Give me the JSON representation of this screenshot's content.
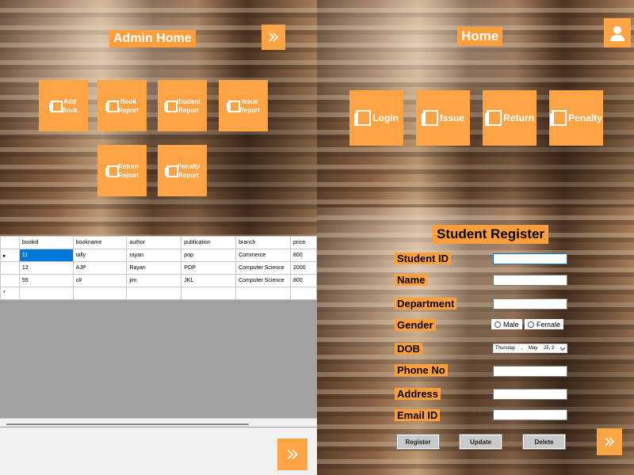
{
  "admin_home": {
    "title": "Admin Home",
    "tiles": [
      {
        "label_line1": "Add",
        "label_line2": "Book"
      },
      {
        "label_line1": "Book",
        "label_line2": "Report"
      },
      {
        "label_line1": "Student",
        "label_line2": "Report"
      },
      {
        "label_line1": "Issue",
        "label_line2": "Report"
      },
      {
        "label_line1": "Return",
        "label_line2": "Report"
      },
      {
        "label_line1": "Penalty",
        "label_line2": "Report"
      }
    ],
    "nav_icon": "double-chevron-right-icon"
  },
  "home": {
    "title": "Home",
    "user_icon": "user-icon",
    "tiles": [
      {
        "label": "Login"
      },
      {
        "label": "Issue"
      },
      {
        "label": "Return"
      },
      {
        "label": "Penalty"
      }
    ]
  },
  "book_grid": {
    "columns": [
      "bookid",
      "bookname",
      "author",
      "publication",
      "branch",
      "price"
    ],
    "rows": [
      [
        "11",
        "tally",
        "rayan",
        "pop",
        "Commerce",
        "800"
      ],
      [
        "12",
        "AJP",
        "Rayan",
        "POP",
        "Computer Science",
        "2000"
      ],
      [
        "55",
        "c#",
        "jim",
        "JKL",
        "Computer Science",
        "800"
      ]
    ],
    "current_row_marker": "▸",
    "new_row_marker": "*",
    "nav_icon": "double-chevron-right-icon"
  },
  "student_register": {
    "title": "Student Register",
    "labels": {
      "student_id": "Student ID",
      "name": "Name",
      "department": "Department",
      "gender": "Gender",
      "dob": "DOB",
      "phone": "Phone No",
      "address": "Address",
      "email": "Email ID"
    },
    "gender_options": [
      "Male",
      "Female"
    ],
    "dob_value": {
      "day": "Thursday",
      "sep": ",",
      "month": "May",
      "date": "25, 2"
    },
    "buttons": {
      "register": "Register",
      "update": "Update",
      "delete": "Delete"
    },
    "nav_icon": "double-chevron-right-icon"
  },
  "colors": {
    "accent": "#ff9e3d",
    "selection": "#0078d7",
    "grid_empty": "#a0a0a0"
  }
}
